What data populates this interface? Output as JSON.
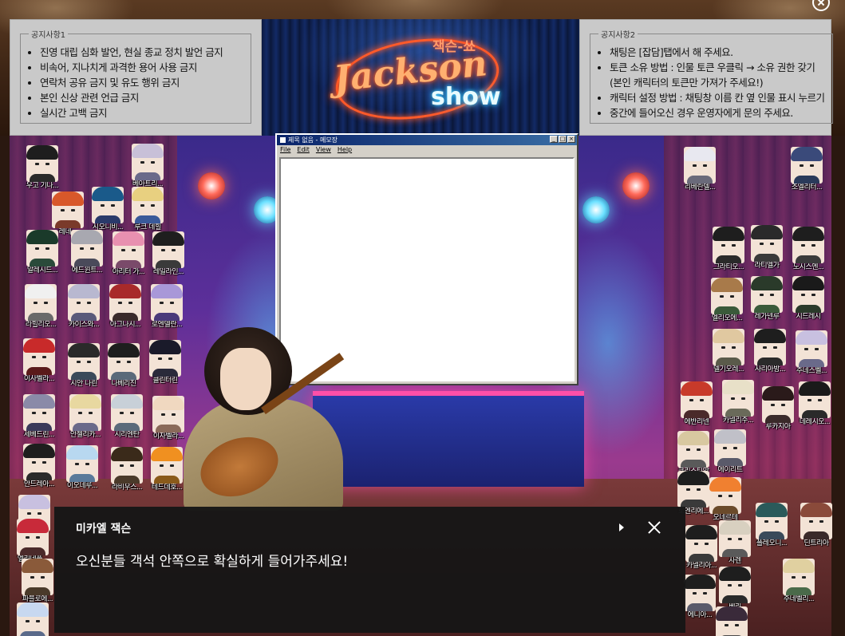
{
  "notice_left": {
    "legend": "공지사항1",
    "items": [
      "진영 대립 심화 발언, 현실 종교 정치 발언 금지",
      "비속어, 지나치게 과격한 용어 사용 금지",
      "연락처 공유 금지 및 유도 행위 금지",
      "본인 신상 관련 언급 금지",
      "실시간 고백 금지"
    ]
  },
  "notice_right": {
    "legend": "공지사항2",
    "items": [
      "채팅은 [잡담]탭에서 해 주세요.",
      "토큰 소유 방법 : 인물 토큰 우클릭 → 소유 권한 갖기",
      "(본인 캐릭터의 토큰만 가져가 주세요!)",
      "캐릭터 설정 방법 : 채팅창 이름 칸 옆 인물 표시 누르기",
      "중간에 들어오신 경우 운영자에게 문의 주세요."
    ]
  },
  "logo": {
    "korean": "잭슨-쑈",
    "english": "Jackson",
    "show": "show"
  },
  "notepad": {
    "title": "제목 없음 - 메모장",
    "menu": [
      "File",
      "Edit",
      "View",
      "Help"
    ]
  },
  "tokens": [
    {
      "name": "우고 기나...",
      "hair": "#1e1e1e",
      "body": "#2a2a2a"
    },
    {
      "name": "베아트리...",
      "hair": "#c8c0d8",
      "body": "#6a6a8a"
    },
    {
      "name": "레네...",
      "hair": "#d8582a",
      "body": "#7a3a2a"
    },
    {
      "name": "시오니비...",
      "hair": "#1a5a8a",
      "body": "#2a3a6a"
    },
    {
      "name": "루크 데힐",
      "hair": "#e8d080",
      "body": "#3a5a9a"
    },
    {
      "name": "알레시드...",
      "hair": "#1a3a2a",
      "body": "#2a4a3a"
    },
    {
      "name": "에드윈트...",
      "hair": "#a8a8b0",
      "body": "#4a4a5a"
    },
    {
      "name": "아리터 가...",
      "hair": "#e890b0",
      "body": "#7a4a6a"
    },
    {
      "name": "레일라인...",
      "hair": "#1e1e1e",
      "body": "#3a3a3a"
    },
    {
      "name": "라힐리오...",
      "hair": "#f0f0f0",
      "body": "#6a6a6a"
    },
    {
      "name": "카이스와...",
      "hair": "#b8b8d0",
      "body": "#5a5a7a"
    },
    {
      "name": "아그나시...",
      "hair": "#a82a2a",
      "body": "#3a2a2a"
    },
    {
      "name": "로엔델란...",
      "hair": "#a898d8",
      "body": "#4a3a7a"
    },
    {
      "name": "이사벨라...",
      "hair": "#c82a2a",
      "body": "#5a1a1a"
    },
    {
      "name": "시안 나린",
      "hair": "#2a2a2a",
      "body": "#3a4a5a"
    },
    {
      "name": "나베리진",
      "hair": "#1e1e1e",
      "body": "#5a6a7a"
    },
    {
      "name": "클린터린",
      "hair": "#1a1a2a",
      "body": "#2a2a3a"
    },
    {
      "name": "세베드린...",
      "hair": "#8a8aa8",
      "body": "#3a3a5a"
    },
    {
      "name": "안젤리카...",
      "hair": "#e8d8a0",
      "body": "#6a6a8a"
    },
    {
      "name": "시리엔탄",
      "hair": "#c8d0d8",
      "body": "#5a6a7a"
    },
    {
      "name": "이자벨라...",
      "hair": "#f0d8c0",
      "body": "#8a6a5a"
    },
    {
      "name": "안드레아...",
      "hair": "#1e1e1e",
      "body": "#2a2a2a"
    },
    {
      "name": "이오네루...",
      "hair": "#b8d8f0",
      "body": "#5a7a9a"
    },
    {
      "name": "라비우스...",
      "hair": "#3a2a1a",
      "body": "#4a3a2a"
    },
    {
      "name": "테드데호...",
      "hair": "#f09020",
      "body": "#8a5a1a"
    },
    {
      "name": "로엔...",
      "hair": "#c8c0e0",
      "body": "#5a5a7a"
    },
    {
      "name": "엘리네플...",
      "hair": "#c82a3a",
      "body": "#4a2a2a"
    },
    {
      "name": "파블로에...",
      "hair": "#8a5a3a",
      "body": "#4a3a2a"
    },
    {
      "name": "아사...",
      "hair": "#c8d8f0",
      "body": "#5a6a8a"
    },
    {
      "name": "리베란델...",
      "hair": "#e8e8f0",
      "body": "#6a6a7a"
    },
    {
      "name": "조엘리터...",
      "hair": "#3a4a7a",
      "body": "#2a3a5a"
    },
    {
      "name": "그라티오...",
      "hair": "#1e1e1e",
      "body": "#2a2a2a"
    },
    {
      "name": "라티엘가",
      "hair": "#2a2a2a",
      "body": "#3a3a3a"
    },
    {
      "name": "노시스엔...",
      "hair": "#1e1e1e",
      "body": "#3a3a3a"
    },
    {
      "name": "엘리오에...",
      "hair": "#a87a4a",
      "body": "#3a5a3a"
    },
    {
      "name": "레가넨루",
      "hair": "#2a3a2a",
      "body": "#3a5a3a"
    },
    {
      "name": "시드레시",
      "hair": "#1a1a1a",
      "body": "#2a3a2a"
    },
    {
      "name": "델기오레...",
      "hair": "#e0c8a0",
      "body": "#5a5a4a"
    },
    {
      "name": "사리아방...",
      "hair": "#1e1e1e",
      "body": "#2a2a2a"
    },
    {
      "name": "주네스벨...",
      "hair": "#c8c0e0",
      "body": "#6a6a8a"
    },
    {
      "name": "에반리넨",
      "hair": "#c83a2a",
      "body": "#4a2a2a"
    },
    {
      "name": "카넬리주...",
      "hair": "#e8e0c8",
      "body": "#6a6a5a"
    },
    {
      "name": "루카지아",
      "hair": "#2a1a1a",
      "body": "#3a2a2a"
    },
    {
      "name": "데레시오...",
      "hair": "#1a1a1a",
      "body": "#2a2a2a"
    },
    {
      "name": "크리스티앙",
      "hair": "#d8c8a0",
      "body": "#5a5a5a"
    },
    {
      "name": "에이리트",
      "hair": "#c0c0c8",
      "body": "#5a5a6a"
    },
    {
      "name": "로엔리에...",
      "hair": "#1e1e1e",
      "body": "#3a3a3a"
    },
    {
      "name": "오네르테",
      "hair": "#f08030",
      "body": "#6a4a2a"
    },
    {
      "name": "플레오니...",
      "hair": "#2a5a5a",
      "body": "#3a4a5a"
    },
    {
      "name": "딘트리아",
      "hair": "#8a4a3a",
      "body": "#3a2a2a"
    },
    {
      "name": "카넬리아...",
      "hair": "#1e1e1e",
      "body": "#3a3a3a"
    },
    {
      "name": "사렌",
      "hair": "#d8d0c0",
      "body": "#5a5a5a"
    },
    {
      "name": "주네벨리...",
      "hair": "#e0d0a0",
      "body": "#4a6a4a"
    },
    {
      "name": "에니아...",
      "hair": "#1e1e1e",
      "body": "#5a5a6a"
    },
    {
      "name": "베리",
      "hair": "#1e1e1e",
      "body": "#2a2a2a"
    },
    {
      "name": "엘리아네코...",
      "hair": "#3a2a3a",
      "body": "#4a4a4a"
    }
  ],
  "dialog": {
    "speaker": "미카엘 잭슨",
    "message": "오신분들 객석 안쪽으로 확실하게 들어가주세요!"
  }
}
